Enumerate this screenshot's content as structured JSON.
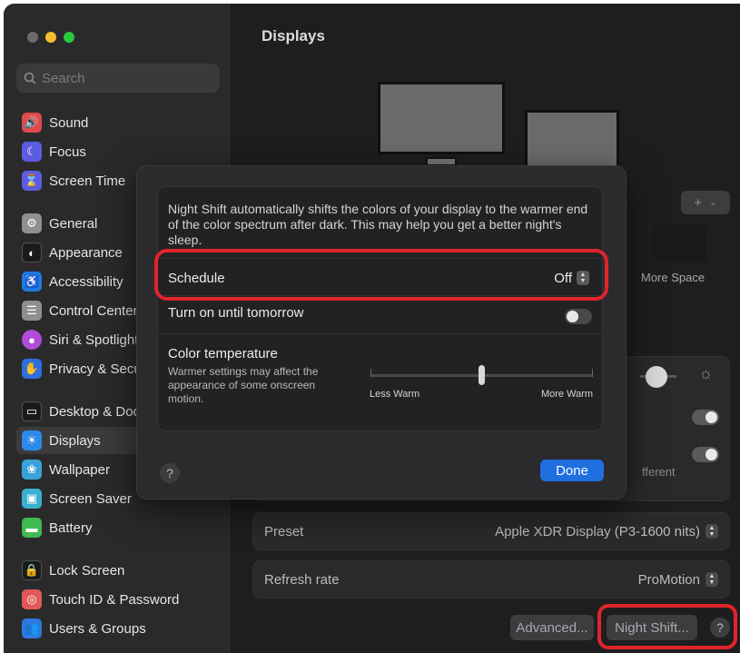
{
  "sidebar": {
    "search_placeholder": "Search",
    "items": [
      {
        "label": "Sound",
        "icon": "speaker-icon",
        "color": "#e0484a"
      },
      {
        "label": "Focus",
        "icon": "moon-icon",
        "color": "#5c5ce0"
      },
      {
        "label": "Screen Time",
        "icon": "hourglass-icon",
        "color": "#5c5ce0"
      },
      {
        "label": "General",
        "icon": "gear-icon",
        "color": "#8e8e93"
      },
      {
        "label": "Appearance",
        "icon": "appearance-icon",
        "color": "#1a1a1a"
      },
      {
        "label": "Accessibility",
        "icon": "accessibility-icon",
        "color": "#1f7ae0"
      },
      {
        "label": "Control Center",
        "icon": "control-center-icon",
        "color": "#8e8e93"
      },
      {
        "label": "Siri & Spotlight",
        "icon": "siri-icon",
        "color": "#b04cd8"
      },
      {
        "label": "Privacy & Security",
        "icon": "hand-icon",
        "color": "#2e6fe0"
      },
      {
        "label": "Desktop & Dock",
        "icon": "dock-icon",
        "color": "#1a1a1a"
      },
      {
        "label": "Displays",
        "icon": "sun-icon",
        "color": "#2e8ae8"
      },
      {
        "label": "Wallpaper",
        "icon": "wallpaper-icon",
        "color": "#3aa2d8"
      },
      {
        "label": "Screen Saver",
        "icon": "screensaver-icon",
        "color": "#3ab0d0"
      },
      {
        "label": "Battery",
        "icon": "battery-icon",
        "color": "#3fb950"
      },
      {
        "label": "Lock Screen",
        "icon": "lock-icon",
        "color": "#1a1a1a"
      },
      {
        "label": "Touch ID & Password",
        "icon": "fingerprint-icon",
        "color": "#e0585a"
      },
      {
        "label": "Users & Groups",
        "icon": "users-icon",
        "color": "#2e7ae0"
      }
    ]
  },
  "main": {
    "title": "Displays",
    "more_space": "More Space",
    "partial_text": "fferent",
    "preset_label": "Preset",
    "preset_value": "Apple XDR Display (P3-1600 nits)",
    "refresh_label": "Refresh rate",
    "refresh_value": "ProMotion",
    "advanced_button": "Advanced...",
    "night_shift_button": "Night Shift...",
    "help": "?",
    "add_button": "+"
  },
  "sheet": {
    "description": "Night Shift automatically shifts the colors of your display to the warmer end of the color spectrum after dark. This may help you get a better night's sleep.",
    "schedule_label": "Schedule",
    "schedule_value": "Off",
    "turn_on_label": "Turn on until tomorrow",
    "color_temp_label": "Color temperature",
    "color_temp_note": "Warmer settings may affect the appearance of some onscreen motion.",
    "less_warm": "Less Warm",
    "more_warm": "More Warm",
    "done_button": "Done",
    "help": "?",
    "temperature_level": 0.5
  }
}
